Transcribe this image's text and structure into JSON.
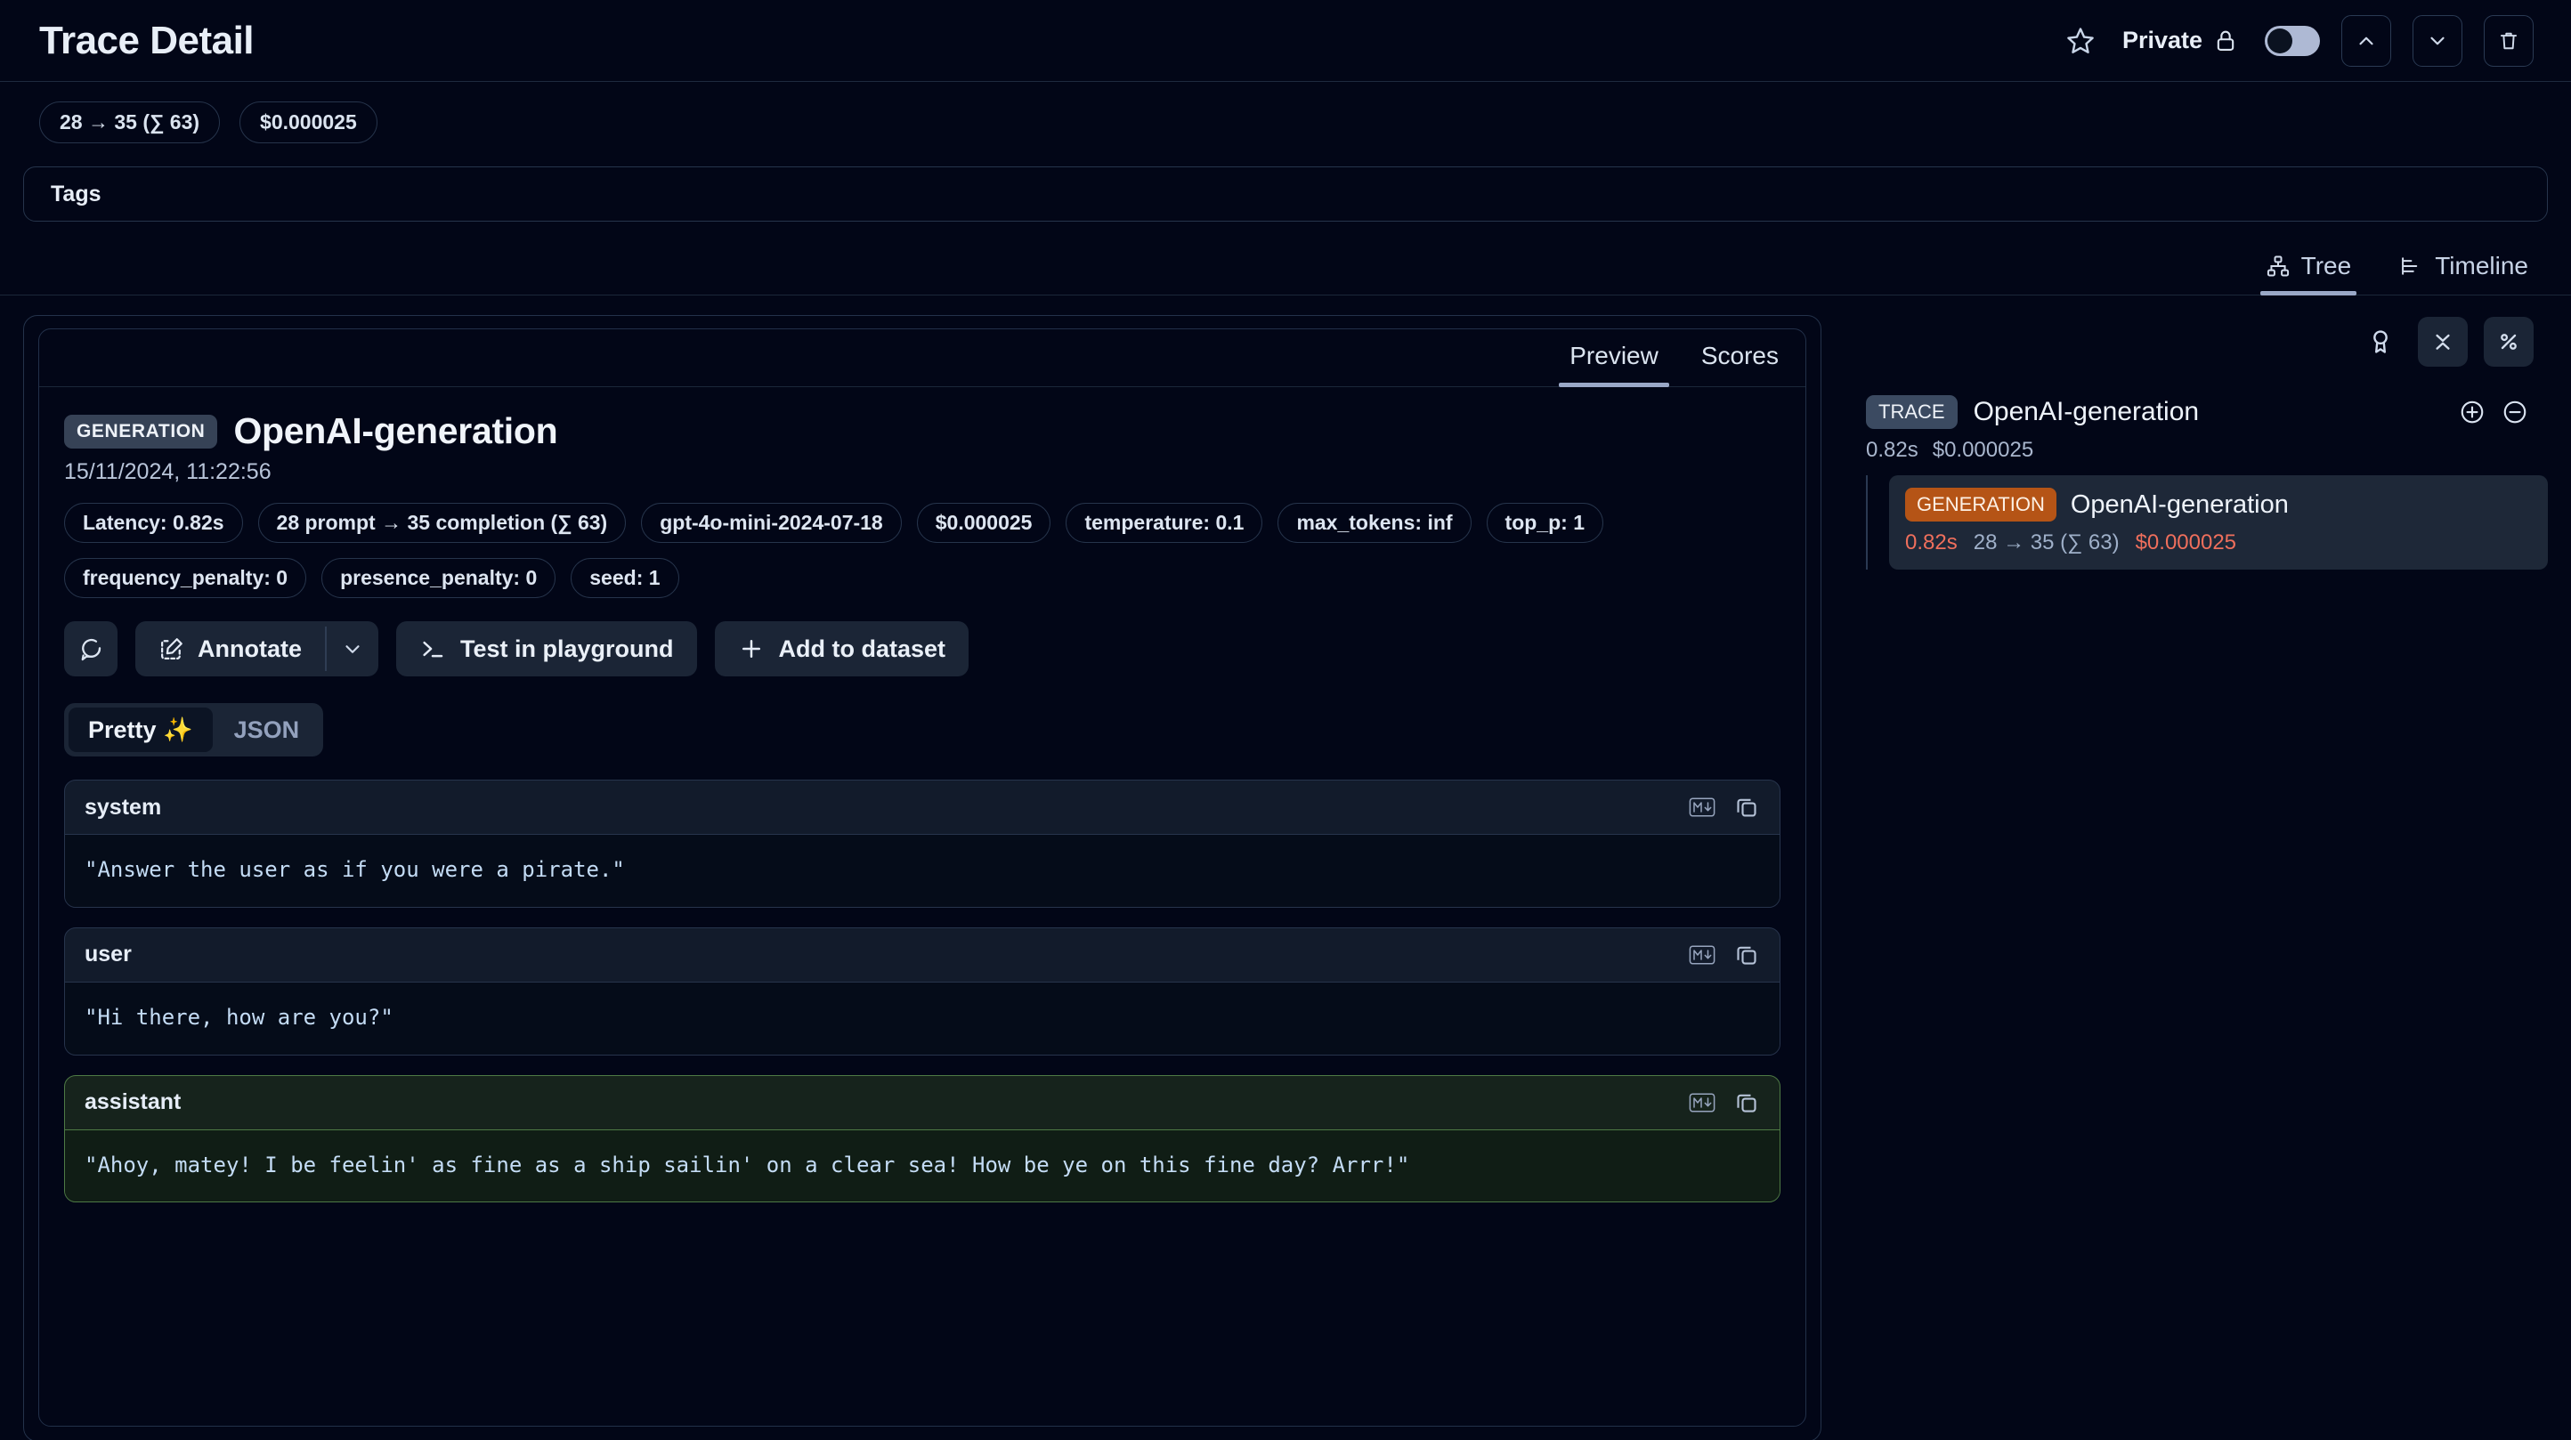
{
  "header": {
    "title": "Trace Detail",
    "star_icon": "star-icon",
    "privacy_label": "Private",
    "lock_icon": "lock-icon",
    "toggle_state": "off",
    "prev_icon": "chevron-up-icon",
    "next_icon": "chevron-down-icon",
    "delete_icon": "trash-icon"
  },
  "metrics": [
    {
      "name": "token-usage",
      "label": "28 → 35 (∑ 63)"
    },
    {
      "name": "total-cost",
      "label": "$0.000025"
    }
  ],
  "tags": {
    "label": "Tags"
  },
  "view_tabs": [
    {
      "name": "tab-tree",
      "label": "Tree",
      "icon": "tree-icon",
      "active": true
    },
    {
      "name": "tab-timeline",
      "label": "Timeline",
      "icon": "timeline-icon",
      "active": false
    }
  ],
  "card_tabs": [
    {
      "name": "tab-preview",
      "label": "Preview",
      "active": true
    },
    {
      "name": "tab-scores",
      "label": "Scores",
      "active": false
    }
  ],
  "observation": {
    "type_badge": "GENERATION",
    "name": "OpenAI-generation",
    "timestamp": "15/11/2024, 11:22:56",
    "meta_pills": [
      "Latency: 0.82s",
      "28 prompt → 35 completion (∑ 63)",
      "gpt-4o-mini-2024-07-18",
      "$0.000025",
      "temperature: 0.1",
      "max_tokens: inf",
      "top_p: 1",
      "frequency_penalty: 0",
      "presence_penalty: 0",
      "seed: 1"
    ]
  },
  "actions": {
    "comment_icon": "comment-icon",
    "annotate_label": "Annotate",
    "annotate_icon": "edit-square-icon",
    "annotate_caret_icon": "chevron-down-icon",
    "playground_label": "Test in playground",
    "playground_icon": "terminal-icon",
    "dataset_label": "Add to dataset",
    "dataset_icon": "plus-icon"
  },
  "format_toggle": {
    "pretty_label": "Pretty ✨",
    "json_label": "JSON",
    "active": "pretty"
  },
  "messages": [
    {
      "role": "system",
      "content": "\"Answer the user as if you were a pirate.\"",
      "variant": "default",
      "markdown_icon": "markdown-icon",
      "copy_icon": "copy-icon"
    },
    {
      "role": "user",
      "content": "\"Hi there, how are you?\"",
      "variant": "default",
      "markdown_icon": "markdown-icon",
      "copy_icon": "copy-icon"
    },
    {
      "role": "assistant",
      "content": "\"Ahoy, matey! I be feelin' as fine as a ship sailin' on a clear sea! How be ye on this fine day? Arrr!\"",
      "variant": "assistant",
      "markdown_icon": "markdown-icon",
      "copy_icon": "copy-icon"
    }
  ],
  "sidebar": {
    "tools": [
      {
        "name": "score-ribbon-icon",
        "style": "plain"
      },
      {
        "name": "collapse-icon",
        "style": "box"
      },
      {
        "name": "percent-icon",
        "style": "box"
      }
    ],
    "tree": {
      "root": {
        "badge": "TRACE",
        "name": "OpenAI-generation",
        "latency": "0.82s",
        "cost": "$0.000025",
        "expand_icon": "plus-circle-icon",
        "collapse_icon": "minus-circle-icon"
      },
      "children": [
        {
          "badge": "GENERATION",
          "name": "OpenAI-generation",
          "latency": "0.82s",
          "tokens": "28 → 35 (∑ 63)",
          "cost": "$0.000025",
          "selected": true
        }
      ]
    }
  },
  "colors": {
    "background": "#020617",
    "accent_generation": "#b55416",
    "accent_trace": "#3b4a61",
    "assistant_border": "#4e7a45",
    "stat_red": "#ef6f5c",
    "tab_underline": "#9aa8c7"
  }
}
